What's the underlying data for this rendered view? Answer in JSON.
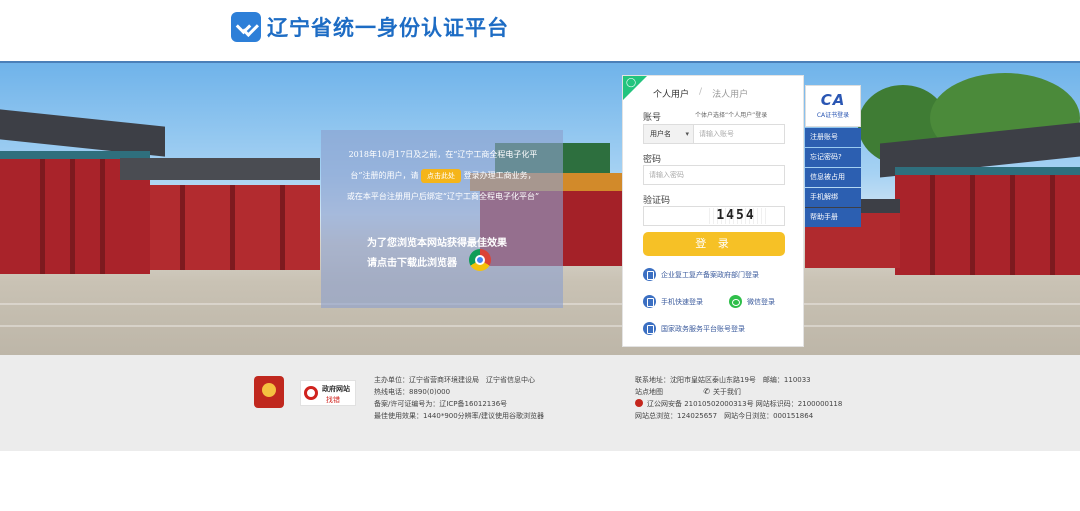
{
  "header": {
    "title": "辽宁省统一身份认证平台"
  },
  "notice": {
    "line1": "2018年10月17日及之前，在“辽宁工商全程电子化平",
    "line2a": "台”注册的用户，请",
    "button": "点击此处",
    "line2b": "登录办理工商业务，",
    "line3": "或在本平台注册用户后绑定“辽宁工商全程电子化平台”",
    "bottom1": "为了您浏览本网站获得最佳效果",
    "bottom2": "请点击下载此浏览器"
  },
  "login": {
    "tab_personal": "个人用户",
    "tab_sep": "/",
    "tab_legal": "法人用户",
    "account_label": "账号",
    "hint": "个体户选择“个人用户”登录",
    "account_type": "用户名",
    "account_placeholder": "请输入账号",
    "password_label": "密码",
    "password_placeholder": "请输入密码",
    "captcha_label": "验证码",
    "captcha_value": "1454",
    "login_button": "登 录",
    "alt1": "企业复工复产备案政府部门登录",
    "alt2": "手机快速登录",
    "alt3": "微信登录",
    "alt4": "国家政务服务平台账号登录"
  },
  "ca": {
    "logo": "CA",
    "sub": "CA证书登录",
    "items": [
      "注册账号",
      "忘记密码?",
      "信息被占用",
      "手机解绑",
      "帮助手册"
    ]
  },
  "footer": {
    "gov_title": "政府网站",
    "gov_sub": "找错",
    "left_lines": [
      "主办单位：辽宁省营商环境建设局　辽宁省信息中心",
      "热线电话：8890(0)000",
      "备案/许可证编号为：辽ICP备16012136号",
      "最佳使用效果：1440*900分辨率/建议使用谷歌浏览器"
    ],
    "right_line1": "联系地址：沈阳市皇姑区泰山东路19号　邮编：110033",
    "right_line2a": "站点地图",
    "right_line2b": "关于我们",
    "right_line3": "辽公网安备 21010502000313号 网站标识码：2100000118",
    "right_line4": "网站总浏览：124025657　网站今日浏览：000151864"
  },
  "colors": {
    "brand_blue": "#1d6cc4",
    "login_yellow": "#f6c126",
    "ca_blue": "#2c5fb1",
    "corner_green": "#22c47e"
  },
  "icons": [
    "logo-icon",
    "user-icon",
    "chrome-icon",
    "building-icon",
    "phone-icon",
    "wechat-icon",
    "gov-service-icon",
    "emblem-icon",
    "police-badge-icon"
  ]
}
